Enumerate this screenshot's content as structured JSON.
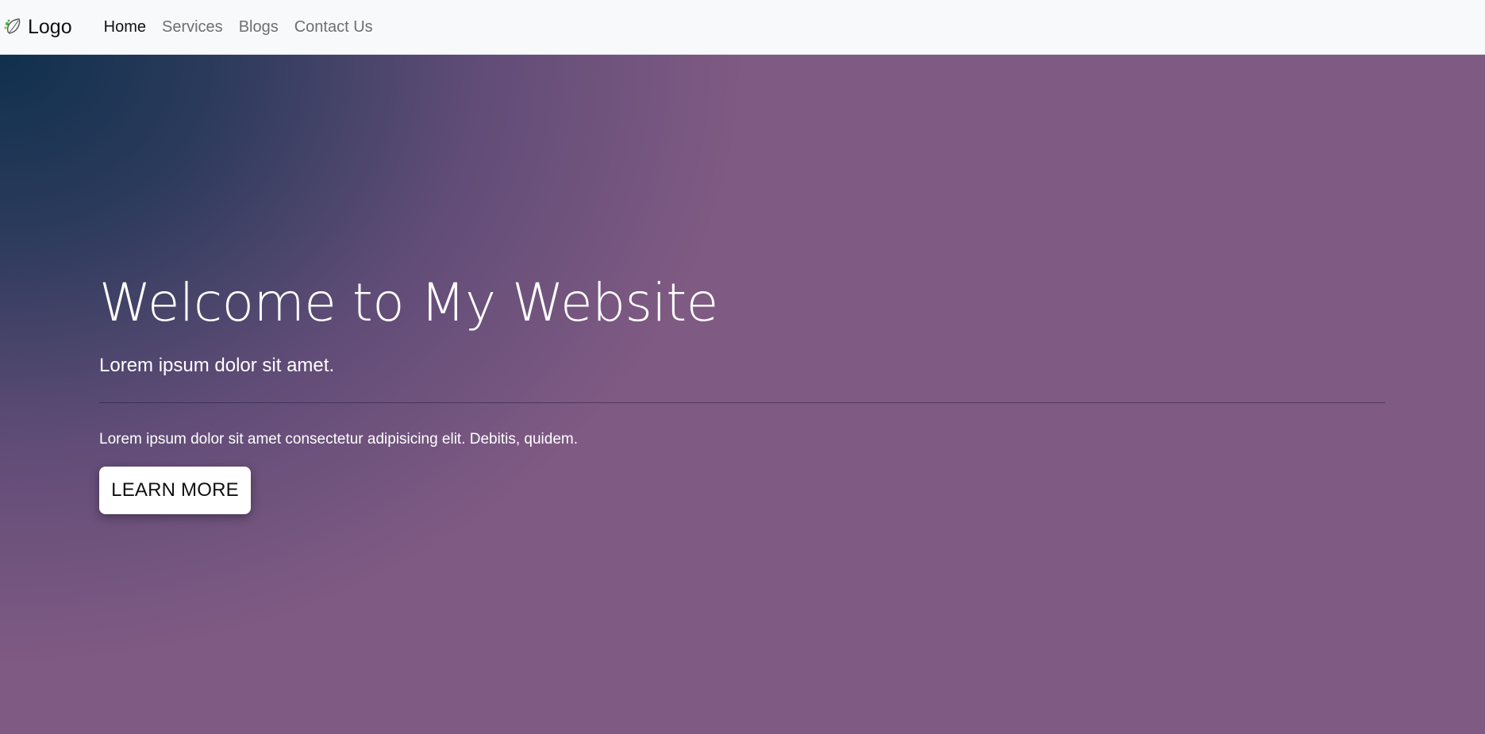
{
  "navbar": {
    "brand": {
      "icon": "leaf-logo-icon",
      "label": "Logo"
    },
    "links": [
      {
        "label": "Home",
        "active": true
      },
      {
        "label": "Services",
        "active": false
      },
      {
        "label": "Blogs",
        "active": false
      },
      {
        "label": "Contact Us",
        "active": false
      }
    ]
  },
  "hero": {
    "title": "Welcome to My Website",
    "subtitle": "Lorem ipsum dolor sit amet.",
    "body": "Lorem ipsum dolor sit amet consectetur adipisicing elit. Debitis, quidem.",
    "button_label": "LEARN MORE"
  },
  "colors": {
    "navbar_bg": "#f8f9fa",
    "hero_gradient_start": "#10304e",
    "hero_gradient_end": "#7f5a83",
    "text_light": "#ffffff",
    "nav_link": "#6c6f73",
    "nav_link_active": "#111111"
  }
}
